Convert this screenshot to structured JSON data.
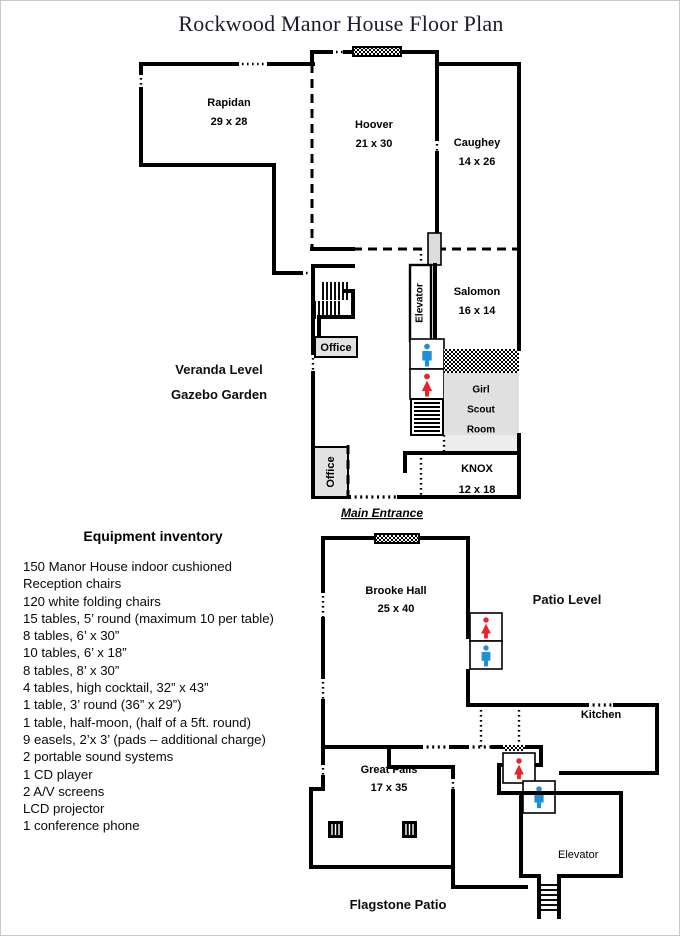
{
  "document": {
    "title": "Rockwood Manor House Floor Plan"
  },
  "upper_level": {
    "level_label": "Veranda Level",
    "garden_label": "Gazebo Garden",
    "entrance_label": "Main Entrance",
    "rooms": [
      {
        "name": "Rapidan",
        "dimensions": "29 x 28"
      },
      {
        "name": "Hoover",
        "dimensions": "21 x 30"
      },
      {
        "name": "Caughey",
        "dimensions": "14 x 26"
      },
      {
        "name": "Salomon",
        "dimensions": "16 x 14"
      },
      {
        "name": "KNOX",
        "dimensions": "12 x 18"
      }
    ],
    "girl_scout_room": [
      "Girl",
      "Scout",
      "Room"
    ],
    "elevator_label": "Elevator",
    "office_label_upper": "Office",
    "office_label_lower": "Office"
  },
  "lower_level": {
    "level_label": "Patio Level",
    "patio_label": "Flagstone Patio",
    "rooms": [
      {
        "name": "Brooke Hall",
        "dimensions": "25 x 40"
      },
      {
        "name": "Great Falls",
        "dimensions": "17 x 35"
      },
      {
        "name": "Kitchen",
        "dimensions": ""
      }
    ],
    "elevator_label": "Elevator"
  },
  "inventory": {
    "heading": "Equipment inventory",
    "items": [
      "150 Manor House indoor cushioned",
      "Reception chairs",
      "120 white folding chairs",
      "15 tables,  5’ round (maximum 10 per table)",
      "8 tables,  6’ x 30”",
      "10 tables,  6’ x 18”",
      "8 tables,  8’ x 30”",
      "4 tables, high cocktail, 32” x 43”",
      "1 table, 3’ round (36” x 29”)",
      "1 table, half-moon, (half of a 5ft. round)",
      "9 easels, 2’x 3’ (pads – additional  charge)",
      "2 portable  sound  systems",
      "1 CD player",
      "2 A/V screens",
      "LCD projector",
      "1 conference phone"
    ]
  },
  "colors": {
    "wall": "#000000",
    "page": "#ffffff",
    "title_text": "#1b1b2b",
    "room_fill_gray": "#e2e2e2",
    "restroom_male": "#1f8fd6",
    "restroom_female": "#e8232a"
  },
  "icons": {
    "restroom_male": "male-restroom-icon",
    "restroom_female": "female-restroom-icon",
    "stairs": "stairs-icon",
    "column": "column-icon",
    "door": "door-icon"
  }
}
